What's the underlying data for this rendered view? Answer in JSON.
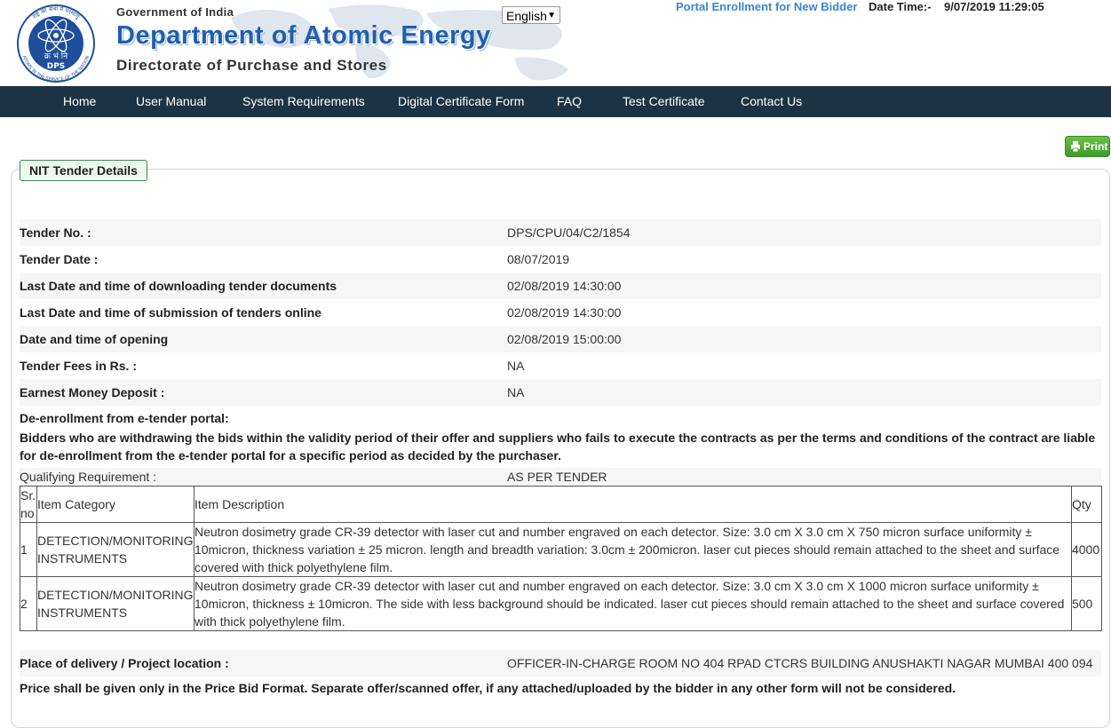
{
  "header": {
    "emblem_top_text": "राष्ट्र की सेवा में परमाणु",
    "emblem_center_text": "क्र भं नि",
    "emblem_dps": "DPS",
    "emblem_bottom_text": "ATOMS IN THE SERVICE OF THE NATION",
    "gov_label": "Government of India",
    "dept_label": "Department of Atomic Energy",
    "directorate_label": "Directorate of Purchase and Stores",
    "language_selected": "English",
    "enroll_link": "Portal Enrollment for New Bidder",
    "datetime_label": "Date Time:-",
    "datetime_value": "9/07/2019 11:29:05"
  },
  "nav": {
    "items": [
      "Home",
      "User Manual",
      "System Requirements",
      "Digital Certificate Form",
      "FAQ",
      "Test Certificate",
      "Contact Us"
    ]
  },
  "print_label": "Print",
  "panel_title": "NIT Tender Details",
  "details": [
    {
      "label": "Tender No. :",
      "value": "DPS/CPU/04/C2/1854"
    },
    {
      "label": "Tender Date :",
      "value": "08/07/2019"
    },
    {
      "label": "Last Date and time of downloading tender documents",
      "value": "02/08/2019 14:30:00"
    },
    {
      "label": "Last Date and time of submission of tenders online",
      "value": "02/08/2019 14:30:00"
    },
    {
      "label": "Date and time of opening",
      "value": "02/08/2019 15:00:00"
    },
    {
      "label": "Tender Fees in Rs. :",
      "value": "NA"
    },
    {
      "label": "Earnest Money Deposit :",
      "value": "NA"
    }
  ],
  "deenrollment": {
    "heading": "De-enrollment from e-tender portal:",
    "text": "Bidders who are withdrawing the bids within the validity period of their offer and suppliers who fails to execute the contracts as per the terms and conditions of the contract are liable for de-enrollment from the e-tender portal for a specific period as decided by the purchaser."
  },
  "qualifying": {
    "label": "Qualifying Requirement :",
    "value": "AS PER TENDER"
  },
  "items_table": {
    "headers": {
      "sr": "Sr. no",
      "category": "Item Category",
      "description": "Item Description",
      "qty": "Qty"
    },
    "rows": [
      {
        "sr": "1",
        "category": "DETECTION/MONITORING INSTRUMENTS",
        "description": "Neutron dosimetry grade CR-39 detector with laser cut and number engraved on each detector. Size: 3.0 cm X 3.0 cm X 750 micron surface uniformity ± 10micron, thickness variation ± 25 micron. length and breadth variation: 3.0cm ± 200micron. laser cut pieces should remain attached to the sheet and surface covered with thick polyethylene film.",
        "qty": "4000"
      },
      {
        "sr": "2",
        "category": "DETECTION/MONITORING INSTRUMENTS",
        "description": "Neutron dosimetry grade CR-39 detector with laser cut and number engraved on each detector. Size: 3.0 cm X 3.0 cm X 1000 micron surface uniformity ± 10micron, thickness ± 10micron. The side with less background should be indicated. laser cut pieces should remain attached to the sheet and surface covered with thick polyethylene film.",
        "qty": "500"
      }
    ]
  },
  "place": {
    "label": "Place of delivery / Project location :",
    "value": "OFFICER-IN-CHARGE ROOM NO 404 RPAD CTCRS BUILDING ANUSHAKTI NAGAR MUMBAI 400 094"
  },
  "price_note": "Price shall be given only in the Price Bid Format. Separate offer/scanned offer, if any attached/uploaded by the bidder in any other form will not be considered.",
  "colors": {
    "nav_bg": "#1c3344",
    "dept_blue": "#1f5fad",
    "link_blue": "#3a87c8",
    "print_green": "#4faa33"
  }
}
